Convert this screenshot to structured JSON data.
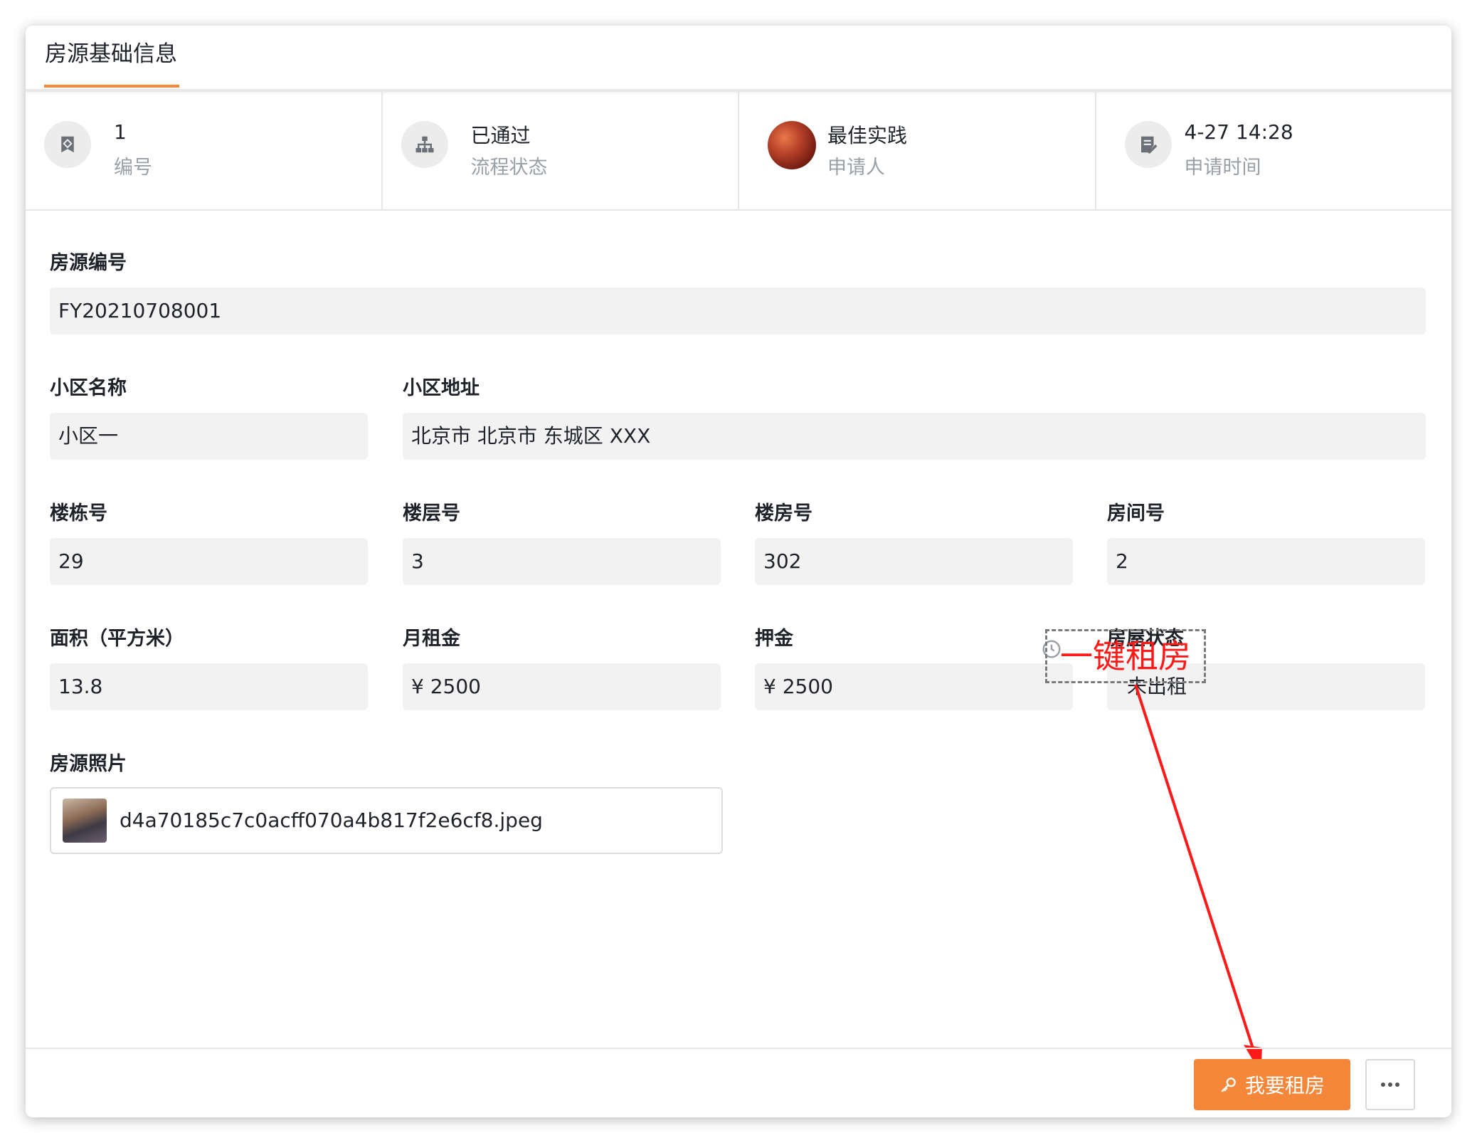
{
  "tab": {
    "title": "房源基础信息"
  },
  "stats": [
    {
      "value": "1",
      "label": "编号",
      "icon": "tag-icon"
    },
    {
      "value": "已通过",
      "label": "流程状态",
      "icon": "org-chart-icon"
    },
    {
      "value": "最佳实践",
      "label": "申请人",
      "icon": "avatar"
    },
    {
      "value": "4-27 14:28",
      "label": "申请时间",
      "icon": "edit-note-icon"
    }
  ],
  "form": {
    "listing_id": {
      "label": "房源编号",
      "value": "FY20210708001"
    },
    "community_name": {
      "label": "小区名称",
      "value": "小区一"
    },
    "community_address": {
      "label": "小区地址",
      "value": "北京市 北京市 东城区 XXX"
    },
    "building_no": {
      "label": "楼栋号",
      "value": "29"
    },
    "floor_no": {
      "label": "楼层号",
      "value": "3"
    },
    "unit_no": {
      "label": "楼房号",
      "value": "302"
    },
    "room_no": {
      "label": "房间号",
      "value": "2"
    },
    "area": {
      "label": "面积（平方米）",
      "value": "13.8"
    },
    "monthly_rent": {
      "label": "月租金",
      "value": "¥ 2500"
    },
    "deposit": {
      "label": "押金",
      "value": "¥ 2500"
    },
    "house_status": {
      "label": "房屋状态",
      "value": "未出租"
    },
    "photos": {
      "label": "房源照片",
      "file_name": "d4a70185c7c0acff070a4b817f2e6cf8.jpeg"
    }
  },
  "annotation": {
    "text": "一键租房"
  },
  "footer": {
    "rent_button": "我要租房",
    "more_button": "···"
  },
  "colors": {
    "accent": "#f4873a",
    "annotation": "#ff1a1a"
  }
}
